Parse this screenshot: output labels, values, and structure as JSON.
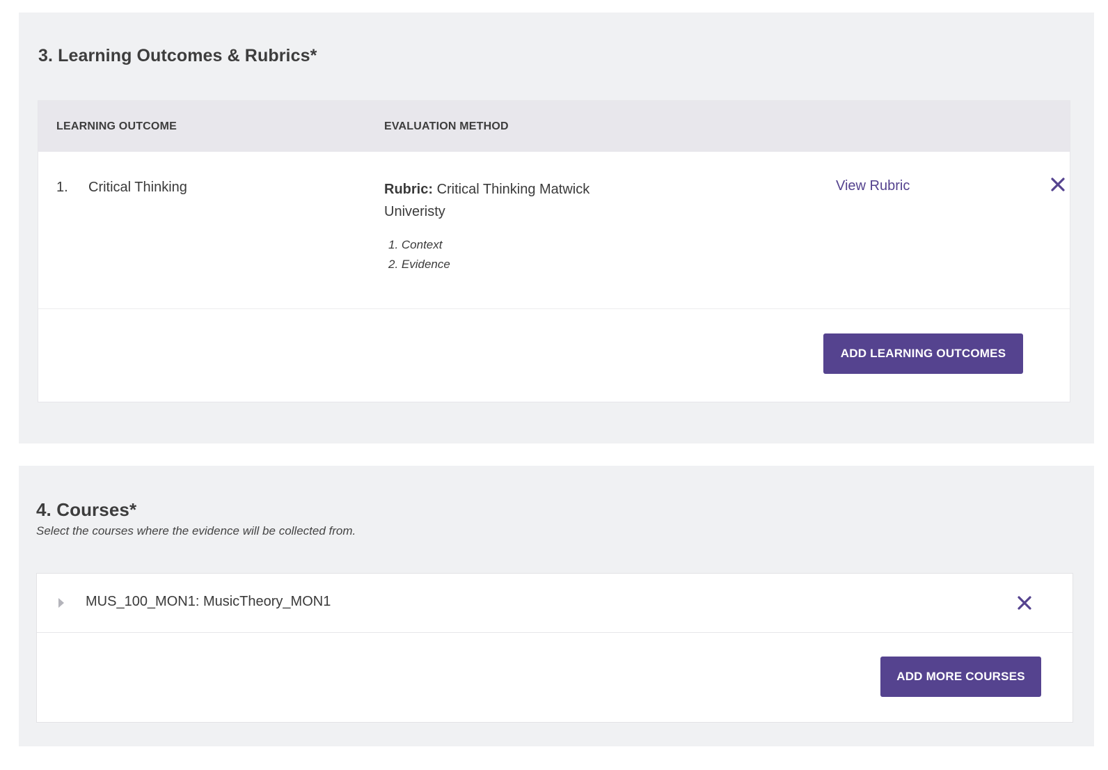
{
  "outcomes_section": {
    "title": "3. Learning Outcomes & Rubrics*",
    "columns": [
      "LEARNING OUTCOME",
      "EVALUATION METHOD"
    ],
    "rows": [
      {
        "number": "1.",
        "outcome": "Critical Thinking",
        "rubric_label": "Rubric:",
        "rubric_name": "Critical Thinking Matwick Univeristy",
        "criteria": [
          "1. Context",
          "2. Evidence"
        ],
        "view_link": "View Rubric",
        "remove_icon": "close-icon"
      }
    ],
    "add_button": "ADD LEARNING OUTCOMES"
  },
  "courses_section": {
    "title": "4. Courses*",
    "subtitle": "Select the courses where the evidence will be collected from.",
    "courses": [
      {
        "name": "MUS_100_MON1: MusicTheory_MON1",
        "expand_icon": "caret-right-icon",
        "remove_icon": "close-icon"
      }
    ],
    "add_button": "ADD MORE COURSES"
  },
  "colors": {
    "accent": "#55438f",
    "panel_background": "#f0f1f3",
    "table_header": "#e8e7ec",
    "link": "#54428e"
  }
}
